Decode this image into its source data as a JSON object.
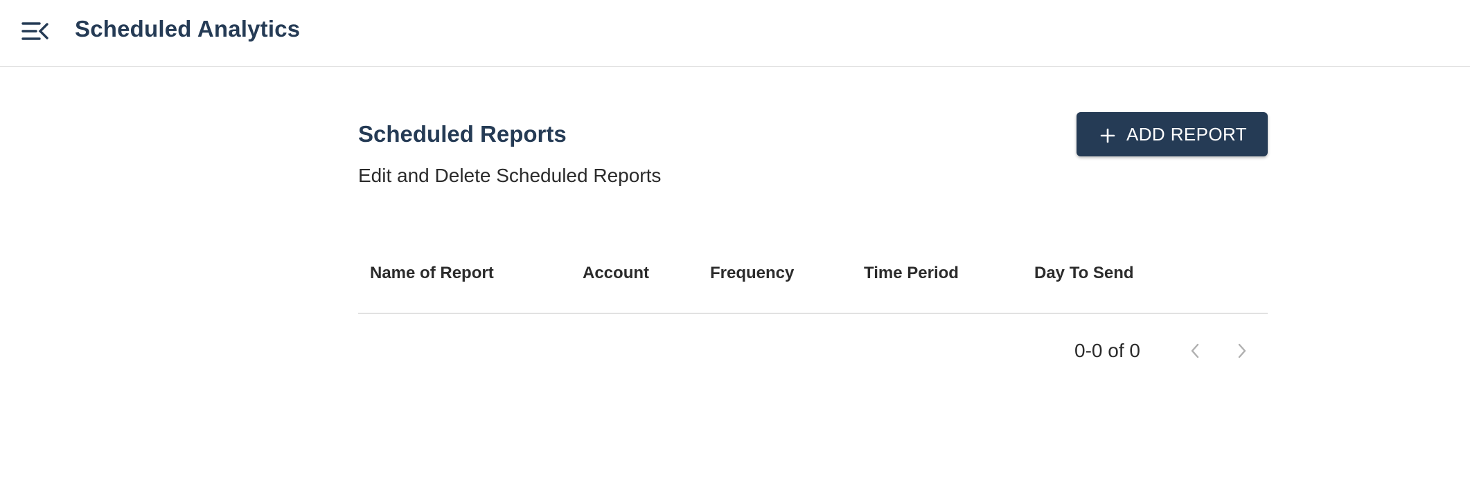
{
  "header": {
    "app_title": "Scheduled Analytics",
    "menu_icon": "menu-collapse-icon"
  },
  "section": {
    "title": "Scheduled Reports",
    "subtitle": "Edit and Delete Scheduled Reports",
    "add_button_label": "ADD REPORT",
    "add_button_icon": "plus-icon"
  },
  "table": {
    "columns": [
      "Name of Report",
      "Account",
      "Frequency",
      "Time Period",
      "Day To Send"
    ],
    "rows": []
  },
  "pagination": {
    "range_text": "0-0 of 0",
    "prev_icon": "chevron-left-icon",
    "next_icon": "chevron-right-icon"
  },
  "colors": {
    "brand": "#253b55",
    "text": "#2b2b2b",
    "divider": "#d6d6d6",
    "disabled": "#b0b0b0"
  }
}
